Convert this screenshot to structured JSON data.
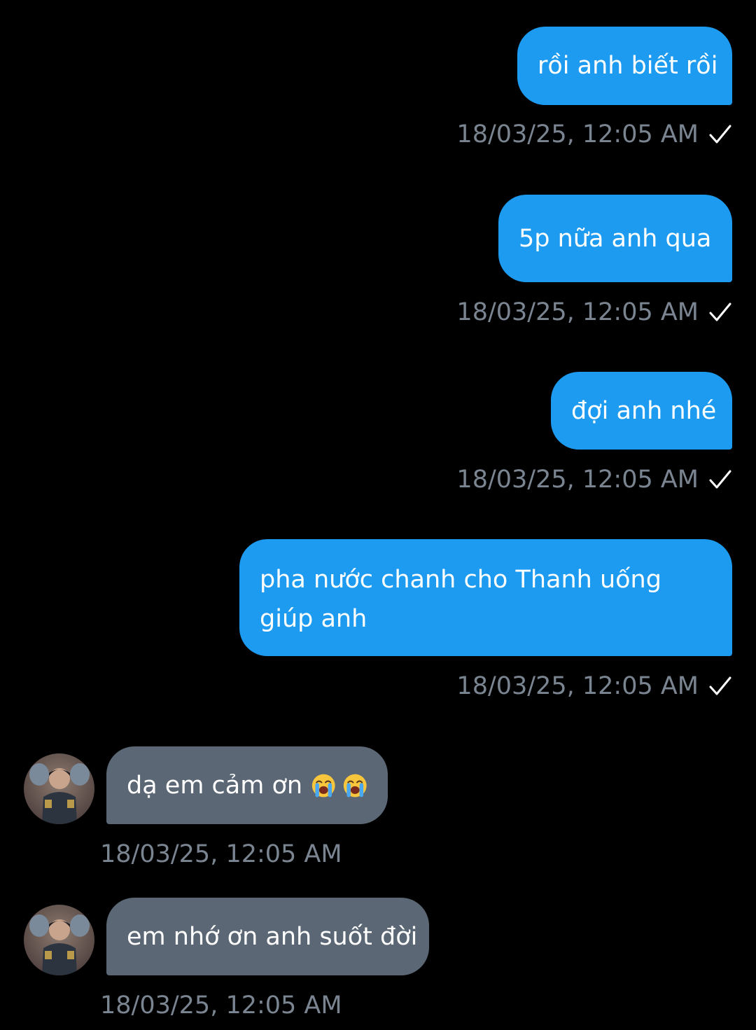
{
  "conversation": {
    "messages": [
      {
        "text": "rồi anh biết rồi",
        "time": "18/03/25, 12:05 AM",
        "direction": "outgoing",
        "status_icon": "check-icon"
      },
      {
        "text": "5p nữa anh qua",
        "time": "18/03/25, 12:05 AM",
        "direction": "outgoing",
        "status_icon": "check-icon"
      },
      {
        "text": "đợi anh nhé",
        "time": "18/03/25, 12:05 AM",
        "direction": "outgoing",
        "status_icon": "check-icon"
      },
      {
        "text": "pha nước chanh cho Thanh uống giúp anh",
        "time": "18/03/25, 12:05 AM",
        "direction": "outgoing",
        "status_icon": "check-icon"
      },
      {
        "text": "dạ em cảm ơn",
        "emojis": [
          "loudly-crying-face-emoji",
          "loudly-crying-face-emoji"
        ],
        "time": "18/03/25, 12:05 AM",
        "direction": "incoming"
      },
      {
        "text": "em nhớ ơn anh suốt đời",
        "time": "18/03/25, 12:05 AM",
        "direction": "incoming"
      }
    ]
  },
  "colors": {
    "background": "#000000",
    "outgoing_bubble": "#1d9bf0",
    "incoming_bubble": "#5b6774",
    "timestamp": "#7a8591"
  }
}
